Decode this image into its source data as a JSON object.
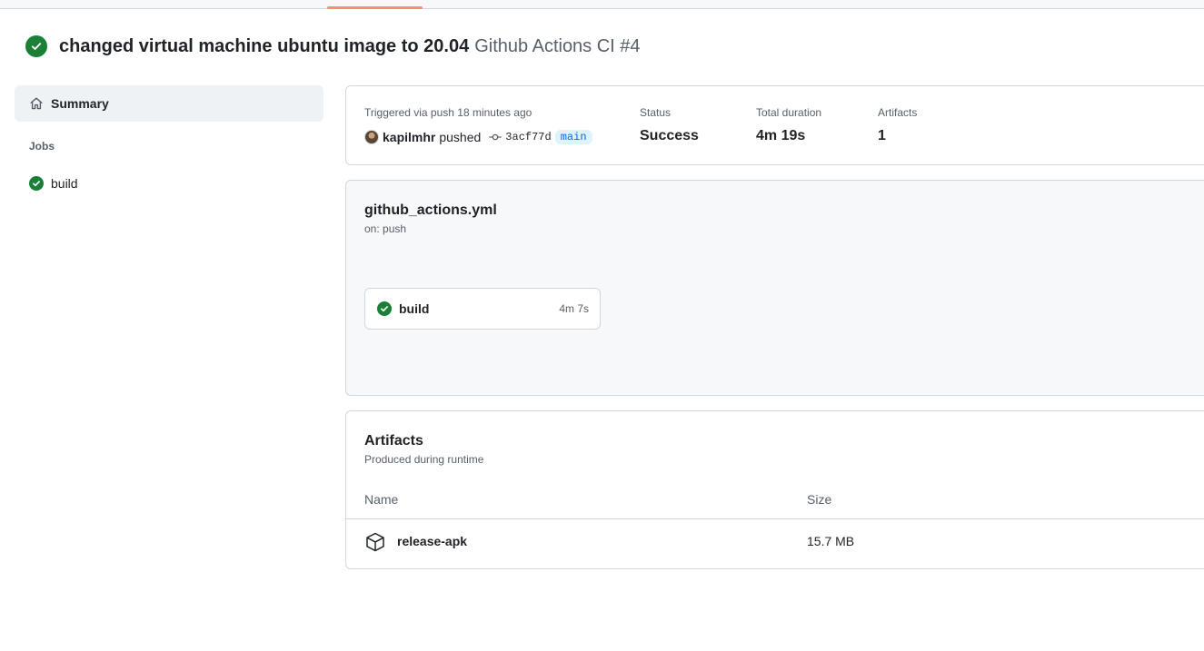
{
  "run": {
    "title": "changed virtual machine ubuntu image to 20.04",
    "workflow_ref": "Github Actions CI #4"
  },
  "sidebar": {
    "summary_label": "Summary",
    "jobs_heading": "Jobs",
    "jobs": [
      {
        "label": "build",
        "status": "success"
      }
    ]
  },
  "summary": {
    "trigger_text": "Triggered via push 18 minutes ago",
    "actor": "kapilmhr",
    "action": "pushed",
    "commit_sha": "3acf77d",
    "branch": "main",
    "status_label": "Status",
    "status_value": "Success",
    "duration_label": "Total duration",
    "duration_value": "4m 19s",
    "artifacts_label": "Artifacts",
    "artifacts_value": "1"
  },
  "workflow": {
    "file": "github_actions.yml",
    "trigger": "on: push",
    "jobs": [
      {
        "name": "build",
        "duration": "4m 7s",
        "status": "success"
      }
    ]
  },
  "artifacts": {
    "title": "Artifacts",
    "subtitle": "Produced during runtime",
    "columns": {
      "name": "Name",
      "size": "Size"
    },
    "rows": [
      {
        "name": "release-apk",
        "size": "15.7 MB"
      }
    ]
  },
  "colors": {
    "success": "#1a7f37",
    "link": "#0969da",
    "tab_indicator": "#fd8c73",
    "muted_text": "#57606a",
    "border": "#d0d7de"
  },
  "icons": {
    "status": "check-circle-fill-icon",
    "summary": "home-icon",
    "commit": "git-commit-icon",
    "artifact": "package-icon"
  }
}
